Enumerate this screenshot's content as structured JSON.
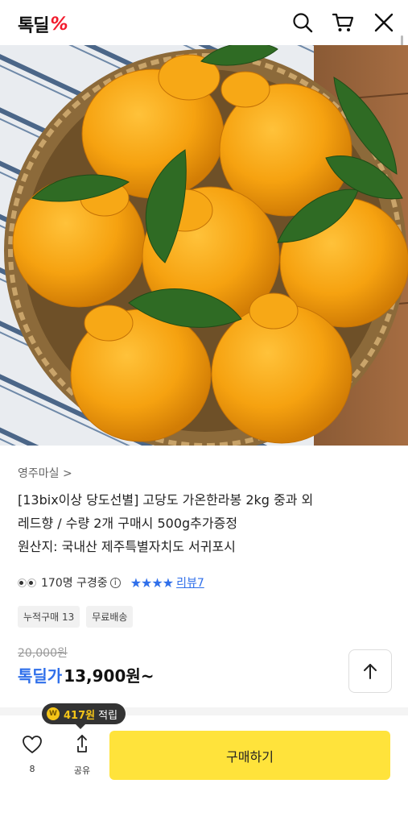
{
  "header": {
    "logo_text": "톡딜",
    "logo_mark": "%",
    "icons": [
      "search-icon",
      "cart-icon",
      "close-icon"
    ]
  },
  "product": {
    "seller": "영주마실 >",
    "title_lines": [
      "[13bix이상 당도선별] 고당도 가온한라봉 2kg 중과 외",
      "레드향 / 수량 2개 구매시 500g추가증정",
      "원산지: 국내산 제주특별자치도 서귀포시"
    ],
    "viewers": "170명 구경중",
    "info_icon": "i",
    "stars": "★★★★",
    "review_link": "리뷰7",
    "badges": [
      "누적구매 13",
      "무료배송"
    ],
    "original_price": "20,000원",
    "sale_label": "톡딜가",
    "sale_price": "13,900원~"
  },
  "bottom": {
    "points_coin": "W",
    "points_amount": "417원",
    "points_label": "적립",
    "like_count": "8",
    "share_label": "공유",
    "buy_label": "구매하기"
  },
  "colors": {
    "accent_blue": "#2f6fea",
    "brand_red": "#f21b2d",
    "buy_yellow": "#ffe33b"
  }
}
